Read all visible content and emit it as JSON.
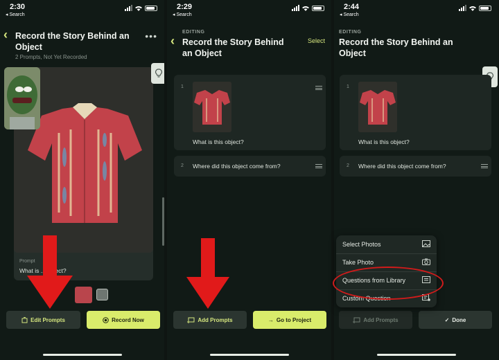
{
  "panels": [
    {
      "status": {
        "time": "2:30",
        "back": "◂ Search"
      },
      "title_line1": "Record the Story Behind an",
      "title_line2": "Object",
      "subtitle": "2 Prompts, Not Yet Recorded",
      "more": "•••",
      "prompt_label": "Prompt",
      "prompt_text": "What is ... object?",
      "buttons": {
        "left": "Edit Prompts",
        "right": "Record Now"
      }
    },
    {
      "status": {
        "time": "2:29",
        "back": "◂ Search"
      },
      "editing": "EDITING",
      "title_line1": "Record the Story Behind",
      "title_line2": "an Object",
      "select": "Select",
      "prompts": [
        {
          "num": "1",
          "text": "What is this object?"
        },
        {
          "num": "2",
          "text": "Where did this object come from?"
        }
      ],
      "buttons": {
        "left": "Add Prompts",
        "right": "Go to Project"
      }
    },
    {
      "status": {
        "time": "2:44",
        "back": "◂ Search"
      },
      "editing": "EDITING",
      "title_line1": "Record the Story Behind an",
      "title_line2": "Object",
      "prompts": [
        {
          "num": "1",
          "text": "What is this object?"
        },
        {
          "num": "2",
          "text": "Where did this object come from?"
        }
      ],
      "menu": [
        "Select Photos",
        "Take Photo",
        "Questions from Library",
        "Custom Question"
      ],
      "buttons": {
        "left": "Add Prompts",
        "right": "Done"
      }
    }
  ],
  "colors": {
    "accent": "#d6e77f",
    "lime_button": "#d9ec6b",
    "annotation_red": "#d21b1b",
    "background": "#111a16"
  },
  "icons": [
    "search-back-icon",
    "signal-icon",
    "wifi-icon",
    "battery-icon",
    "chevron-left-icon",
    "more-icon",
    "lightbulb-icon",
    "drag-handle-icon",
    "photo-icon",
    "camera-icon",
    "library-icon",
    "custom-question-icon",
    "add-prompts-icon",
    "arrow-right-icon",
    "checkmark-icon",
    "edit-icon",
    "record-icon",
    "down-arrow-annotation"
  ]
}
